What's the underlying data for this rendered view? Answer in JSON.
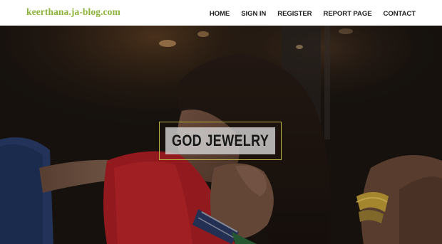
{
  "site": {
    "logo": "keerthana.ja-blog.com"
  },
  "nav": {
    "items": [
      "HOME",
      "SIGN IN",
      "REGISTER",
      "REPORT PAGE",
      "CONTACT"
    ]
  },
  "hero": {
    "title": "GOD JEWELRY",
    "image": "photo of people smiling with bracelets",
    "frame_color": "#b9b443"
  },
  "colors": {
    "logo": "#8cb33a",
    "nav_text": "#1f1f1f",
    "header_bg": "#ffffff"
  }
}
